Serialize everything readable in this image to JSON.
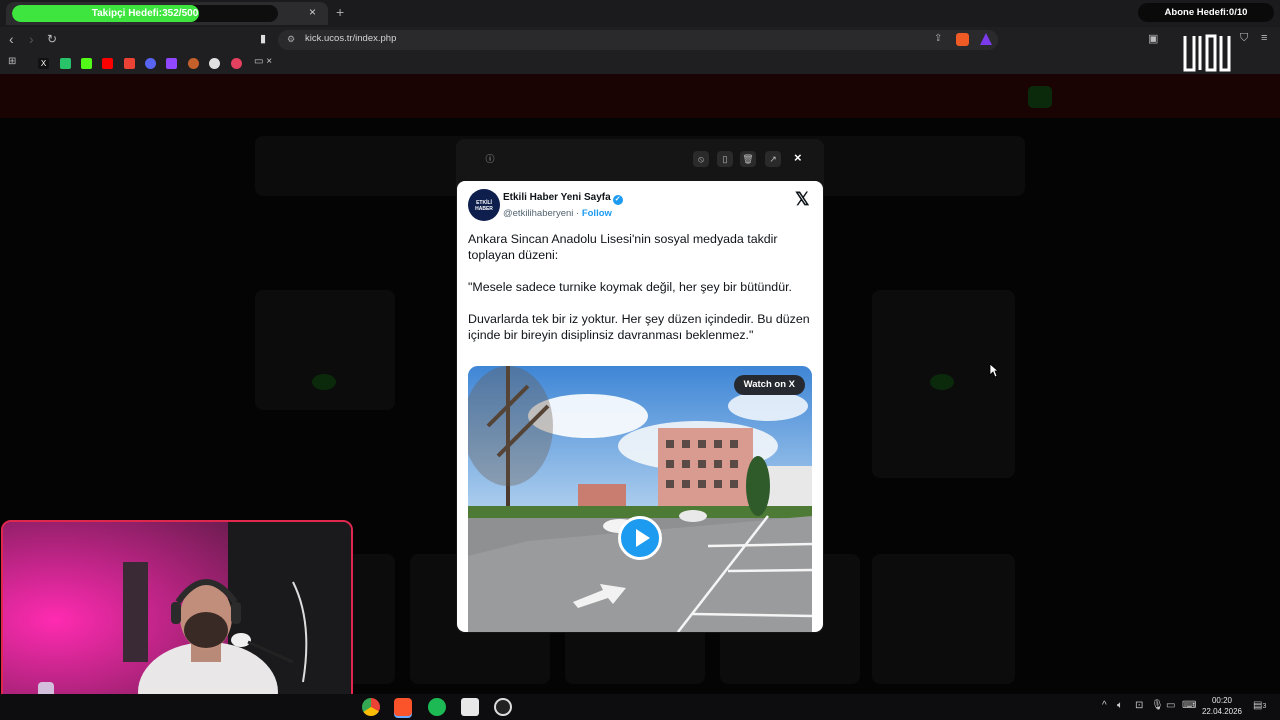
{
  "browser": {
    "tab": {
      "goal_label": "Takipçi Hedefi:352/500",
      "goal_progress": 0.704,
      "close_glyph": "×",
      "new_tab_glyph": "+"
    },
    "subscriber_goal": "Abone Hedefi:0/10",
    "url": "kick.ucos.tr/index.php",
    "bookmarks_folder_close": "×"
  },
  "modal": {
    "toolbar_icons": [
      "info-icon",
      "block-icon",
      "bookmark-icon",
      "trash-icon",
      "external-link-icon",
      "close-icon"
    ],
    "close_glyph": "×"
  },
  "tweet": {
    "author_name": "Etkili Haber Yeni Sayfa",
    "avatar_text": "ETKİLİ HABER",
    "handle": "@etkilihaberyeni",
    "separator": "·",
    "follow_label": "Follow",
    "x_logo": "𝕏",
    "paragraphs": [
      "Ankara Sincan Anadolu Lisesi'nin sosyal medyada takdir toplayan düzeni:",
      "\"Mesele sadece turnike koymak değil, her şey bir bütündür.",
      "Duvarlarda tek bir iz yoktur. Her şey düzen içindedir. Bu düzen içinde bir bireyin disiplinsiz davranması beklenmez.\""
    ],
    "watch_label": "Watch on X"
  },
  "taskbar": {
    "time": "00:20",
    "date": "22.04.2026",
    "notification_count": "3"
  },
  "colors": {
    "progress_green": "#3ee53e",
    "twitter_blue": "#1d9bf0",
    "webcam_border": "#e0284f"
  }
}
